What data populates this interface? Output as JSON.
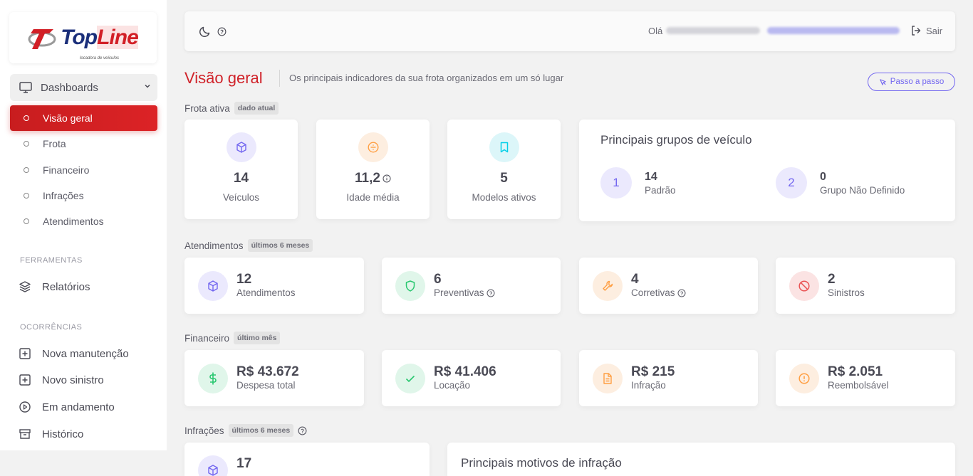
{
  "brand": {
    "logo_main": "Top",
    "logo_accent": "Line",
    "logo_sub": "locadora de veículos"
  },
  "sidebar": {
    "group_label": "Dashboards",
    "items": [
      {
        "label": "Visão geral"
      },
      {
        "label": "Frota"
      },
      {
        "label": "Financeiro"
      },
      {
        "label": "Infrações"
      },
      {
        "label": "Atendimentos"
      }
    ],
    "tools_heading": "FERRAMENTAS",
    "tools": [
      {
        "label": "Relatórios"
      }
    ],
    "occurrences_heading": "OCORRÊNCIAS",
    "occurrences": [
      {
        "label": "Nova manutenção"
      },
      {
        "label": "Novo sinistro"
      },
      {
        "label": "Em andamento"
      },
      {
        "label": "Histórico"
      }
    ]
  },
  "topbar": {
    "greeting": "Olá",
    "logout_label": "Sair"
  },
  "page": {
    "title": "Visão geral",
    "subtitle": "Os principais indicadores da sua frota organizados em um só lugar",
    "guide_label": "Passo a passo"
  },
  "fleet": {
    "label": "Frota ativa",
    "tag": "dado atual",
    "cards": [
      {
        "value": "14",
        "caption": "Veículos"
      },
      {
        "value": "11,2",
        "caption": "Idade média"
      },
      {
        "value": "5",
        "caption": "Modelos ativos"
      }
    ],
    "groups_title": "Principais grupos de veículo",
    "groups": [
      {
        "rank": "1",
        "value": "14",
        "caption": "Padrão"
      },
      {
        "rank": "2",
        "value": "0",
        "caption": "Grupo Não Definido"
      }
    ]
  },
  "services": {
    "label": "Atendimentos",
    "tag": "últimos 6 meses",
    "cards": [
      {
        "value": "12",
        "caption": "Atendimentos"
      },
      {
        "value": "6",
        "caption": "Preventivas"
      },
      {
        "value": "4",
        "caption": "Corretivas"
      },
      {
        "value": "2",
        "caption": "Sinistros"
      }
    ]
  },
  "finance": {
    "label": "Financeiro",
    "tag": "último mês",
    "cards": [
      {
        "value": "R$ 43.672",
        "caption": "Despesa total"
      },
      {
        "value": "R$ 41.406",
        "caption": "Locação"
      },
      {
        "value": "R$ 215",
        "caption": "Infração"
      },
      {
        "value": "R$ 2.051",
        "caption": "Reembolsável"
      }
    ]
  },
  "infractions": {
    "label": "Infrações",
    "tag": "últimos 6 meses",
    "count": "17",
    "reasons_title": "Principais motivos de infração"
  },
  "colors": {
    "accent_red": "#d0232a",
    "accent_purple": "#7367f0"
  }
}
